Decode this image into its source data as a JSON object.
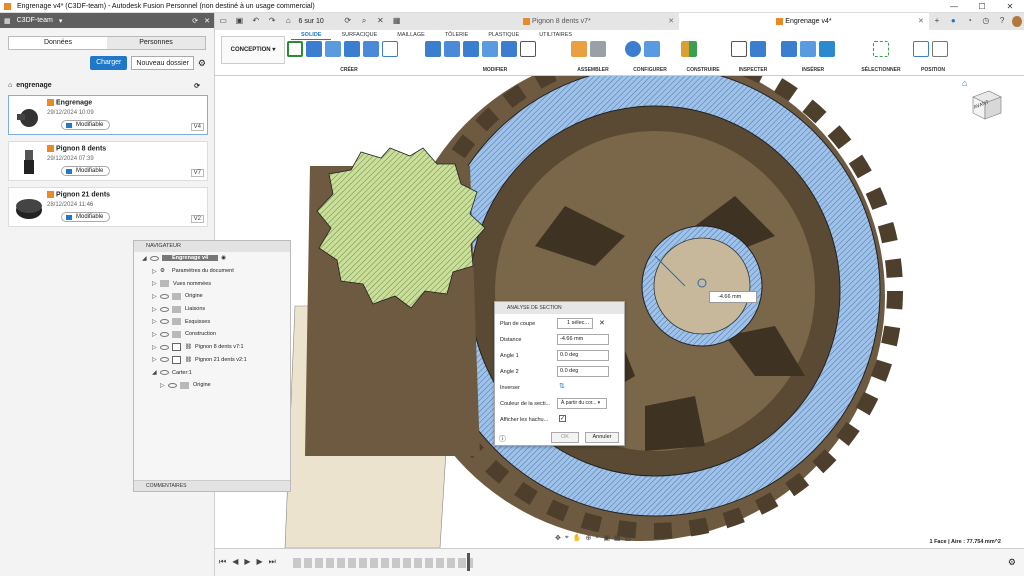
{
  "window": {
    "title": "Engrenage v4* (C3DF-team) - Autodesk Fusion Personnel (non destiné à un usage commercial)"
  },
  "left": {
    "team": "C3DF-team",
    "tab_data": "Données",
    "tab_people": "Personnes",
    "upload": "Charger",
    "new_folder": "Nouveau dossier",
    "folder": "engrenage",
    "files": [
      {
        "name": "Engrenage",
        "date": "29/12/2024 10:09",
        "status": "Modifiable",
        "version": "V4"
      },
      {
        "name": "Pignon 8 dents",
        "date": "29/12/2024 07:39",
        "status": "Modifiable",
        "version": "V7"
      },
      {
        "name": "Pignon 21 dents",
        "date": "28/12/2024 11:46",
        "status": "Modifiable",
        "version": "V2"
      }
    ]
  },
  "tabs": {
    "counter": "6 sur 10",
    "doc_tabs": [
      {
        "label": "Pignon 8 dents v7*"
      },
      {
        "label": "Engrenage v4*"
      }
    ]
  },
  "ribbon": {
    "workspace": "CONCEPTION",
    "tabs": [
      "SOLIDE",
      "SURFACIQUE",
      "MAILLAGE",
      "TÔLERIE",
      "PLASTIQUE",
      "UTILITAIRES"
    ],
    "groups": [
      "CRÉER",
      "MODIFIER",
      "ASSEMBLER",
      "CONFIGURER",
      "CONSTRUIRE",
      "INSPECTER",
      "INSÉRER",
      "SÉLECTIONNER",
      "POSITION"
    ]
  },
  "navigator": {
    "header": "NAVIGATEUR",
    "root": "Engrenage v4",
    "items": [
      "Paramètres du document",
      "Vues nommées",
      "Origine",
      "Liaisons",
      "Esquisses",
      "Construction",
      "Pignon 8 dents v7:1",
      "Pignon 21 dents v2:1",
      "Carter:1",
      "Origine"
    ],
    "footer": "COMMENTAIRES"
  },
  "dialog": {
    "title": "ANALYSE DE SECTION",
    "plane_label": "Plan de coupe",
    "plane_value": "1 sélec...",
    "distance_label": "Distance",
    "distance_value": "-4.66 mm",
    "angle1_label": "Angle 1",
    "angle1_value": "0.0 deg",
    "angle2_label": "Angle 2",
    "angle2_value": "0.0 deg",
    "invert_label": "Inverser",
    "color_label": "Couleur de la secti...",
    "color_value": "À partir du cor...",
    "hatch_label": "Afficher les hachu...",
    "ok": "OK",
    "cancel": "Annuler"
  },
  "viewport": {
    "dimension": "-4.66 mm",
    "status": "1 Face | Aire : 77.754 mm^2",
    "viewcube_label": "AVANT"
  },
  "colors": {
    "accent": "#1f78c8",
    "hatch_blue": "#9ec2ea",
    "hatch_green": "#c9df9a",
    "body_brown": "#6e5a40"
  }
}
